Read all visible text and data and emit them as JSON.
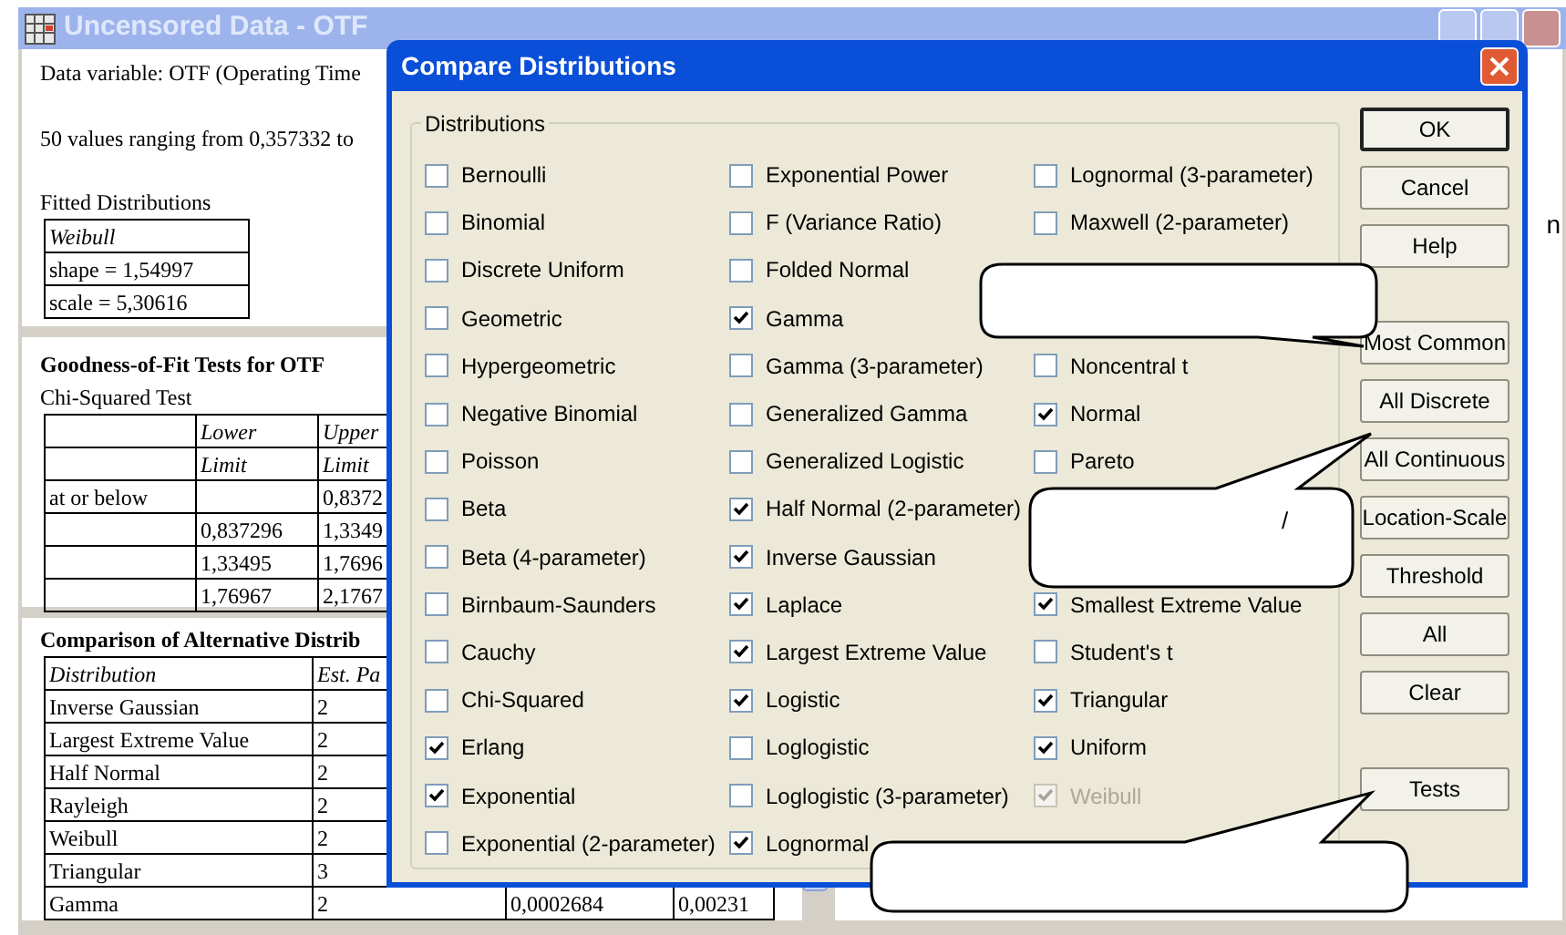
{
  "background_window": {
    "title": "Uncensored Data - OTF",
    "summary": {
      "data_variable": "Data variable: OTF (Operating Time",
      "range": "50 values ranging from 0,357332 to",
      "fitted_heading": "Fitted Distributions",
      "fitted_rows": [
        "Weibull",
        "shape = 1,54997",
        "scale = 5,30616"
      ]
    },
    "goodness": {
      "heading": "Goodness-of-Fit Tests for OTF",
      "subheading": "Chi-Squared Test",
      "header_rows": [
        [
          null,
          "Lower",
          "Upper"
        ],
        [
          null,
          "Limit",
          "Limit"
        ]
      ],
      "rows": [
        [
          "at or below",
          null,
          "0,8372"
        ],
        [
          null,
          "0,837296",
          "1,3349"
        ],
        [
          null,
          "1,33495",
          "1,7696"
        ],
        [
          null,
          "1,76967",
          "2,1767"
        ]
      ]
    },
    "comparison": {
      "heading": "Comparison of Alternative Distrib",
      "columns": [
        "Distribution",
        "Est. Pa",
        null,
        null
      ],
      "rows": [
        [
          "Inverse Gaussian",
          "2",
          null,
          null
        ],
        [
          "Largest Extreme Value",
          "2",
          null,
          null
        ],
        [
          "Half Normal",
          "2",
          null,
          null
        ],
        [
          "Rayleigh",
          "2",
          null,
          null
        ],
        [
          "Weibull",
          "2",
          null,
          null
        ],
        [
          "Triangular",
          "3",
          null,
          null
        ],
        [
          "Gamma",
          "2",
          "0,0002684",
          "0,00231"
        ]
      ]
    },
    "right_pane_text": "n"
  },
  "dialog": {
    "title": "Compare Distributions",
    "group_label": "Distributions",
    "columns": [
      [
        {
          "label": "Bernoulli",
          "checked": false,
          "disabled": false
        },
        {
          "label": "Binomial",
          "checked": false,
          "disabled": false
        },
        {
          "label": "Discrete Uniform",
          "checked": false,
          "disabled": false
        },
        {
          "label": "Geometric",
          "checked": false,
          "disabled": false
        },
        {
          "label": "Hypergeometric",
          "checked": false,
          "disabled": false
        },
        {
          "label": "Negative Binomial",
          "checked": false,
          "disabled": false
        },
        {
          "label": "Poisson",
          "checked": false,
          "disabled": false
        },
        {
          "label": "Beta",
          "checked": false,
          "disabled": false
        },
        {
          "label": "Beta (4-parameter)",
          "checked": false,
          "disabled": false
        },
        {
          "label": "Birnbaum-Saunders",
          "checked": false,
          "disabled": false
        },
        {
          "label": "Cauchy",
          "checked": false,
          "disabled": false
        },
        {
          "label": "Chi-Squared",
          "checked": false,
          "disabled": false
        },
        {
          "label": "Erlang",
          "checked": true,
          "disabled": false
        },
        {
          "label": "Exponential",
          "checked": true,
          "disabled": false
        },
        {
          "label": "Exponential (2-parameter)",
          "checked": false,
          "disabled": false
        }
      ],
      [
        {
          "label": "Exponential Power",
          "checked": false,
          "disabled": false
        },
        {
          "label": "F (Variance Ratio)",
          "checked": false,
          "disabled": false
        },
        {
          "label": "Folded Normal",
          "checked": false,
          "disabled": false
        },
        {
          "label": "Gamma",
          "checked": true,
          "disabled": false
        },
        {
          "label": "Gamma (3-parameter)",
          "checked": false,
          "disabled": false
        },
        {
          "label": "Generalized Gamma",
          "checked": false,
          "disabled": false
        },
        {
          "label": "Generalized Logistic",
          "checked": false,
          "disabled": false
        },
        {
          "label": "Half Normal (2-parameter)",
          "checked": true,
          "disabled": false
        },
        {
          "label": "Inverse Gaussian",
          "checked": true,
          "disabled": false
        },
        {
          "label": "Laplace",
          "checked": true,
          "disabled": false
        },
        {
          "label": "Largest Extreme Value",
          "checked": true,
          "disabled": false
        },
        {
          "label": "Logistic",
          "checked": true,
          "disabled": false
        },
        {
          "label": "Loglogistic",
          "checked": false,
          "disabled": false
        },
        {
          "label": "Loglogistic (3-parameter)",
          "checked": false,
          "disabled": false
        },
        {
          "label": "Lognormal",
          "checked": true,
          "disabled": false
        }
      ],
      [
        {
          "label": "Lognormal (3-parameter)",
          "checked": false,
          "disabled": false
        },
        {
          "label": "Maxwell (2-parameter)",
          "checked": false,
          "disabled": false
        },
        null,
        null,
        {
          "label": "Noncentral t",
          "checked": false,
          "disabled": false
        },
        {
          "label": "Normal",
          "checked": true,
          "disabled": false
        },
        {
          "label": "Pareto",
          "checked": false,
          "disabled": false
        },
        null,
        null,
        {
          "label": "Smallest Extreme Value",
          "checked": true,
          "disabled": false
        },
        {
          "label": "Student's t",
          "checked": false,
          "disabled": false
        },
        {
          "label": "Triangular",
          "checked": true,
          "disabled": false
        },
        {
          "label": "Uniform",
          "checked": true,
          "disabled": false
        },
        {
          "label": "Weibull",
          "checked": true,
          "disabled": true
        },
        null
      ]
    ],
    "button_groups": [
      [
        {
          "label": "OK",
          "default": true
        },
        {
          "label": "Cancel",
          "default": false
        },
        {
          "label": "Help",
          "default": false
        }
      ],
      [
        {
          "label": "Most Common",
          "default": false
        },
        {
          "label": "All Discrete",
          "default": false
        },
        {
          "label": "All Continuous",
          "default": false
        },
        {
          "label": "Location-Scale",
          "default": false
        },
        {
          "label": "Threshold",
          "default": false
        },
        {
          "label": "All",
          "default": false
        },
        {
          "label": "Clear",
          "default": false
        }
      ],
      [
        {
          "label": "Tests",
          "default": false
        }
      ]
    ]
  },
  "callout_text": "/"
}
